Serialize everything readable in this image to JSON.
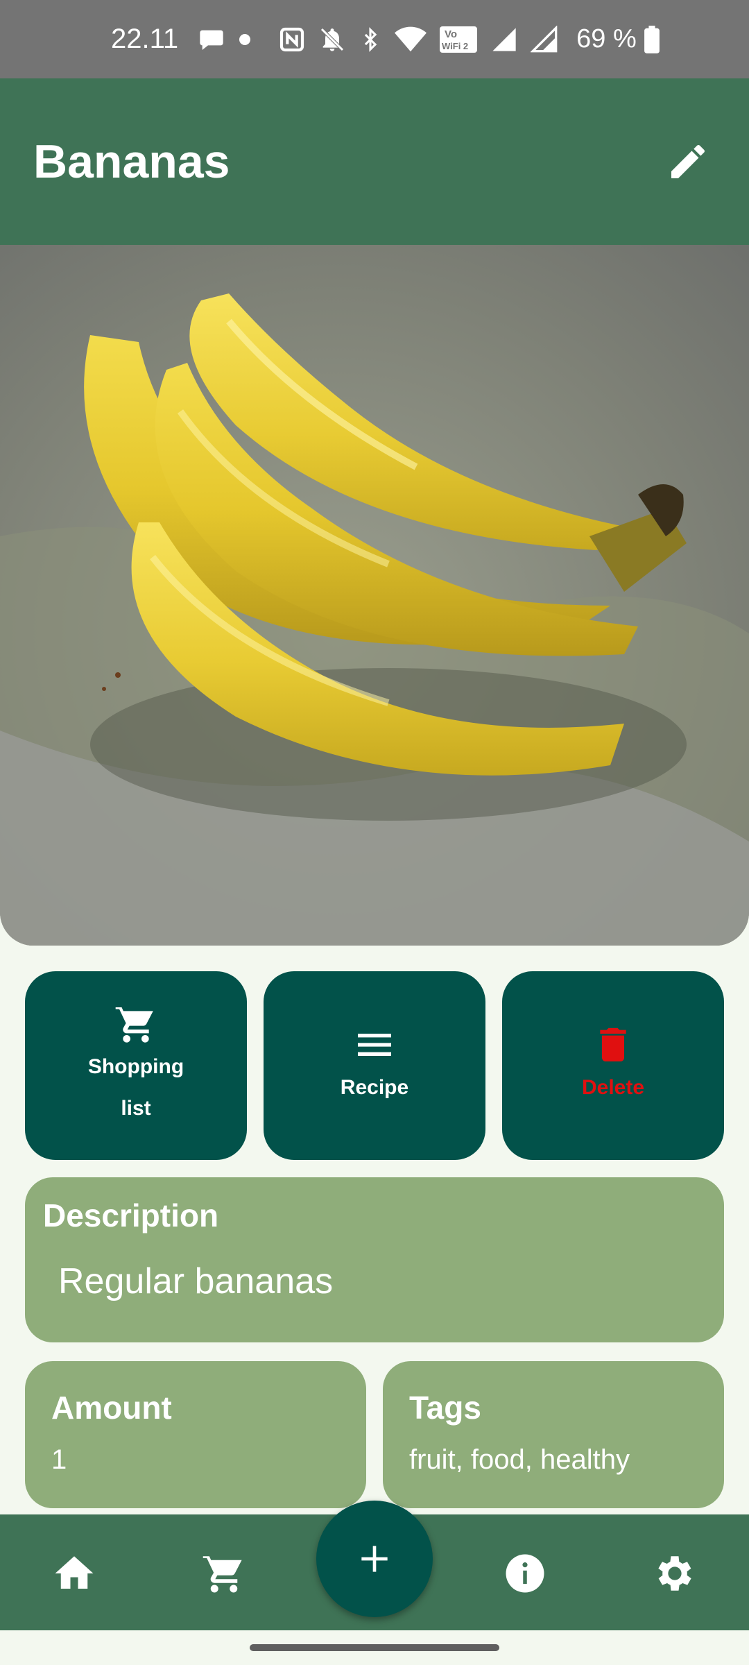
{
  "status_bar": {
    "time": "22.11",
    "battery": "69 %",
    "icons": [
      "chat-bubble-icon",
      "dot-icon",
      "nfc-icon",
      "bell-off-icon",
      "bluetooth-icon",
      "wifi-icon",
      "vowifi-icon",
      "signal-icon",
      "signal-icon",
      "battery-icon"
    ],
    "vowifi_line1": "Vo",
    "vowifi_line2": "WiFi 2"
  },
  "app_bar": {
    "title": "Bananas",
    "edit_icon": "pencil-icon"
  },
  "hero_image": {
    "subject": "bananas-photo"
  },
  "actions": [
    {
      "label": "Shopping list",
      "icon": "cart-icon"
    },
    {
      "label": "Recipe",
      "icon": "menu-icon"
    },
    {
      "label": "Delete",
      "icon": "trash-icon",
      "color": "#e01010"
    }
  ],
  "description": {
    "title": "Description",
    "value": "Regular bananas"
  },
  "amount": {
    "title": "Amount",
    "value": "1"
  },
  "tags": {
    "title": "Tags",
    "value": "fruit, food, healthy"
  },
  "bottom_nav": {
    "items": [
      "home-icon",
      "cart-icon",
      "add-icon",
      "info-icon",
      "gear-icon"
    ]
  },
  "colors": {
    "app_bar": "#3f7356",
    "button": "#02524a",
    "card": "#8fad7a",
    "background": "#f3f8ef",
    "status_bar": "#747474"
  }
}
